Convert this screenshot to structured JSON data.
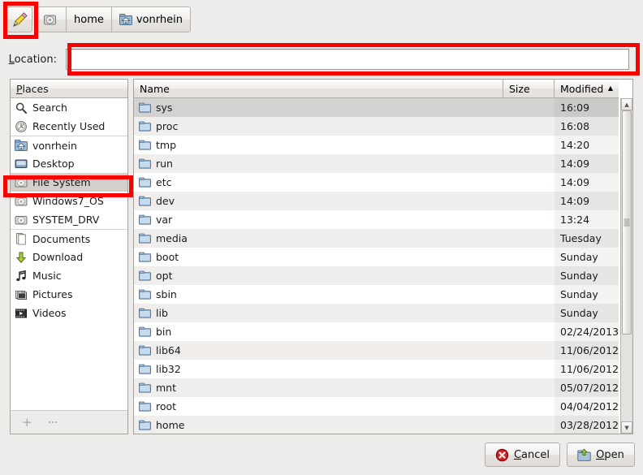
{
  "toolbar": {
    "edit_button": {
      "name": "edit-location-toggle",
      "icon": "pencil-icon"
    },
    "path_segments": [
      {
        "label": "",
        "icon": "drive-icon",
        "icon_only": true,
        "pressed": false
      },
      {
        "label": "home",
        "icon": "",
        "icon_only": false,
        "pressed": false
      },
      {
        "label": "vonrhein",
        "icon": "home-folder-icon",
        "icon_only": false,
        "pressed": false
      }
    ]
  },
  "location": {
    "label": "Location:",
    "label_mnemonic": "L",
    "value": "",
    "placeholder": ""
  },
  "places": {
    "header": "Places",
    "header_mnemonic": "P",
    "items": [
      {
        "label": "Search",
        "icon": "search-icon",
        "separator_above": false,
        "selected": false
      },
      {
        "label": "Recently Used",
        "icon": "recent-clock-icon",
        "separator_above": false,
        "selected": false
      },
      {
        "label": "vonrhein",
        "icon": "home-folder-icon",
        "separator_above": true,
        "selected": false
      },
      {
        "label": "Desktop",
        "icon": "desktop-icon",
        "separator_above": false,
        "selected": false
      },
      {
        "label": "File System",
        "icon": "harddisk-icon",
        "separator_above": false,
        "selected": true
      },
      {
        "label": "Windows7_OS",
        "icon": "harddisk-icon",
        "separator_above": false,
        "selected": false
      },
      {
        "label": "SYSTEM_DRV",
        "icon": "harddisk-icon",
        "separator_above": false,
        "selected": false
      },
      {
        "label": "Documents",
        "icon": "documents-icon",
        "separator_above": true,
        "selected": false
      },
      {
        "label": "Download",
        "icon": "download-arrow-icon",
        "separator_above": false,
        "selected": false
      },
      {
        "label": "Music",
        "icon": "music-note-icon",
        "separator_above": false,
        "selected": false
      },
      {
        "label": "Pictures",
        "icon": "pictures-icon",
        "separator_above": false,
        "selected": false
      },
      {
        "label": "Videos",
        "icon": "video-icon",
        "separator_above": false,
        "selected": false
      }
    ],
    "footer": {
      "add_label": "+",
      "remove_label": "—"
    }
  },
  "file_list": {
    "columns": [
      {
        "key": "name",
        "label": "Name",
        "sorted": false,
        "sort_dir": ""
      },
      {
        "key": "size",
        "label": "Size",
        "sorted": false,
        "sort_dir": ""
      },
      {
        "key": "modified",
        "label": "Modified",
        "sorted": true,
        "sort_dir": "▲"
      }
    ],
    "rows": [
      {
        "name": "sys",
        "size": "",
        "modified": "16:09",
        "icon": "folder-icon",
        "selected": true
      },
      {
        "name": "proc",
        "size": "",
        "modified": "16:08",
        "icon": "folder-icon",
        "selected": false
      },
      {
        "name": "tmp",
        "size": "",
        "modified": "14:20",
        "icon": "folder-icon",
        "selected": false
      },
      {
        "name": "run",
        "size": "",
        "modified": "14:09",
        "icon": "folder-icon",
        "selected": false
      },
      {
        "name": "etc",
        "size": "",
        "modified": "14:09",
        "icon": "folder-icon",
        "selected": false
      },
      {
        "name": "dev",
        "size": "",
        "modified": "14:09",
        "icon": "folder-icon",
        "selected": false
      },
      {
        "name": "var",
        "size": "",
        "modified": "13:24",
        "icon": "folder-icon",
        "selected": false
      },
      {
        "name": "media",
        "size": "",
        "modified": "Tuesday",
        "icon": "folder-icon",
        "selected": false
      },
      {
        "name": "boot",
        "size": "",
        "modified": "Sunday",
        "icon": "folder-icon",
        "selected": false
      },
      {
        "name": "opt",
        "size": "",
        "modified": "Sunday",
        "icon": "folder-icon",
        "selected": false
      },
      {
        "name": "sbin",
        "size": "",
        "modified": "Sunday",
        "icon": "folder-icon",
        "selected": false
      },
      {
        "name": "lib",
        "size": "",
        "modified": "Sunday",
        "icon": "folder-icon",
        "selected": false
      },
      {
        "name": "bin",
        "size": "",
        "modified": "02/24/2013",
        "icon": "folder-icon",
        "selected": false
      },
      {
        "name": "lib64",
        "size": "",
        "modified": "11/06/2012",
        "icon": "folder-icon",
        "selected": false
      },
      {
        "name": "lib32",
        "size": "",
        "modified": "11/06/2012",
        "icon": "folder-icon",
        "selected": false
      },
      {
        "name": "mnt",
        "size": "",
        "modified": "05/07/2012",
        "icon": "folder-icon",
        "selected": false
      },
      {
        "name": "root",
        "size": "",
        "modified": "04/04/2012",
        "icon": "folder-icon",
        "selected": false
      },
      {
        "name": "home",
        "size": "",
        "modified": "03/28/2012",
        "icon": "folder-icon",
        "selected": false
      }
    ],
    "scrollbar": {
      "up_arrow": "▲",
      "down_arrow": "▼",
      "thumb_top_pct": 0,
      "thumb_height_pct": 72
    }
  },
  "dialog_buttons": [
    {
      "label": "Cancel",
      "mnemonic": "C",
      "icon": "cancel-x-icon",
      "name": "cancel-button"
    },
    {
      "label": "Open",
      "mnemonic": "O",
      "icon": "open-folder-icon",
      "name": "open-button"
    }
  ],
  "annotations": [
    {
      "id": "rb-edit",
      "name": "annotation-box-edit-button",
      "color": "#fb0000"
    },
    {
      "id": "rb-location",
      "name": "annotation-box-location",
      "color": "#fb0000"
    },
    {
      "id": "rb-fs",
      "name": "annotation-box-file-system",
      "color": "#fb0000"
    }
  ]
}
